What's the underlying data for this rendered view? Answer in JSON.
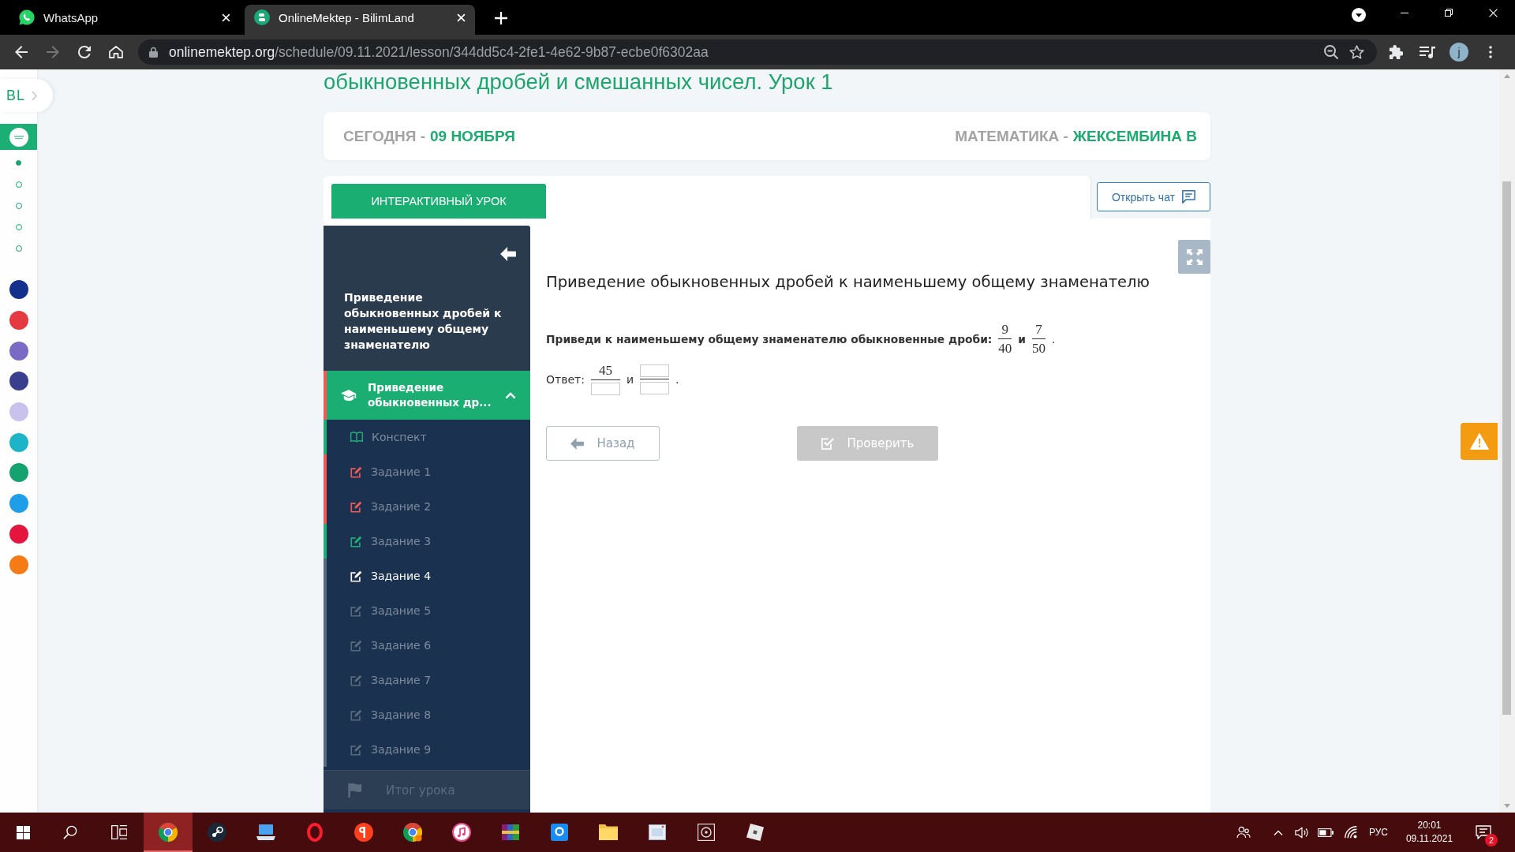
{
  "browser": {
    "tabs": [
      {
        "kind": "chat",
        "title": "WhatsApp",
        "selected": false
      },
      {
        "kind": "site",
        "title": "OnlineMektep - BilimLand",
        "selected": true
      }
    ],
    "address_bar": {
      "host": "onlinemektep.org",
      "path": "/schedule/09.11.2021/lesson/344dd5c4-2fe1-4e62-9b87-ecbe0f6302aa"
    },
    "profile_initial": "j"
  },
  "site_sidebar": {
    "logo": "BL",
    "home": {
      "selected": true
    },
    "steps": [
      {
        "selected": true
      },
      {
        "selected": false
      },
      {
        "selected": false
      },
      {
        "selected": false
      },
      {
        "selected": false
      }
    ],
    "apps": [
      {
        "color": "#13318c"
      },
      {
        "color": "#e63a43"
      },
      {
        "color": "#7a6ac6"
      },
      {
        "color": "#393f8e"
      },
      {
        "color": "#c8c2ec"
      },
      {
        "color": "#1db4c8"
      },
      {
        "color": "#15a271"
      },
      {
        "color": "#1e9de8"
      },
      {
        "color": "#e4163d"
      },
      {
        "color": "#f47b16"
      }
    ]
  },
  "page": {
    "title": "обыкновенных дробей и смешанных чисел. Урок 1",
    "date_bar": {
      "label": "СЕГОДНЯ -",
      "value": "09 НОЯБРЯ"
    },
    "subject_bar": {
      "label": "МАТЕМАТИКА -",
      "value": "ЖЕКСЕМБИНА В"
    }
  },
  "lesson": {
    "tabs": [
      {
        "label": "ИНТЕРАКТИВНЫЙ УРОК",
        "selected": true
      }
    ],
    "chat_button": "Открыть чат",
    "nav": {
      "title": "Приведение обыкновенных дробей к наименьшему общему знаменателю",
      "section": {
        "title": "Приведение обыкновенных др...",
        "color": "#ef5a55",
        "expanded": true
      },
      "items": [
        {
          "kind": "notes",
          "label": "Конспект",
          "color": "#1fae75",
          "selected": false
        },
        {
          "kind": "task",
          "label": "Задание 1",
          "color": "#ef5a55",
          "selected": false
        },
        {
          "kind": "task",
          "label": "Задание 2",
          "color": "#ef5a55",
          "selected": false
        },
        {
          "kind": "task",
          "label": "Задание 3",
          "color": "#1fae75",
          "selected": false
        },
        {
          "kind": "task",
          "label": "Задание 4",
          "color": "#5a6a7d",
          "selected": true
        },
        {
          "kind": "task",
          "label": "Задание 5",
          "color": "#5a6a7d",
          "selected": false
        },
        {
          "kind": "task",
          "label": "Задание 6",
          "color": "#5a6a7d",
          "selected": false
        },
        {
          "kind": "task",
          "label": "Задание 7",
          "color": "#5a6a7d",
          "selected": false
        },
        {
          "kind": "task",
          "label": "Задание 8",
          "color": "#5a6a7d",
          "selected": false
        },
        {
          "kind": "task",
          "label": "Задание 9",
          "color": "#5a6a7d",
          "selected": false
        }
      ],
      "summary": "Итог урока"
    },
    "task": {
      "heading": "Приведение обыкновенных дробей к наименьшему общему знаменателю",
      "question": {
        "prompt": "Приведи к наименьшему общему знаменателю обыкновенные дроби:",
        "fractions": [
          {
            "numerator": {
              "kind": "given",
              "text": "9"
            },
            "denominator": {
              "kind": "given",
              "text": "40"
            }
          },
          {
            "numerator": {
              "kind": "given",
              "text": "7"
            },
            "denominator": {
              "kind": "given",
              "text": "50"
            }
          }
        ],
        "joiner": "и",
        "end": "."
      },
      "answer": {
        "label": "Ответ:",
        "fractions": [
          {
            "numerator": {
              "kind": "given",
              "text": "45"
            },
            "denominator": {
              "kind": "input"
            }
          },
          {
            "numerator": {
              "kind": "input"
            },
            "denominator": {
              "kind": "input"
            }
          }
        ],
        "joiner": "и",
        "end": "."
      },
      "back_button": "Назад",
      "check_button": {
        "label": "Проверить",
        "disabled": true
      }
    }
  },
  "taskbar": {
    "apps": [
      {
        "kind": "browser",
        "active": true
      },
      {
        "kind": "steam",
        "active": false
      },
      {
        "kind": "laptop",
        "active": false
      },
      {
        "kind": "opera",
        "active": false
      },
      {
        "kind": "yandex",
        "active": false
      },
      {
        "kind": "browser-profile",
        "active": false
      },
      {
        "kind": "music",
        "active": false
      },
      {
        "kind": "archive",
        "active": false
      },
      {
        "kind": "tile",
        "active": false
      },
      {
        "kind": "folder",
        "active": false
      },
      {
        "kind": "viewer",
        "active": false
      },
      {
        "kind": "target",
        "active": false
      },
      {
        "kind": "cube",
        "active": false
      }
    ],
    "language": "РУС",
    "time": "20:01",
    "date": "09.11.2021",
    "notifications": "2"
  }
}
